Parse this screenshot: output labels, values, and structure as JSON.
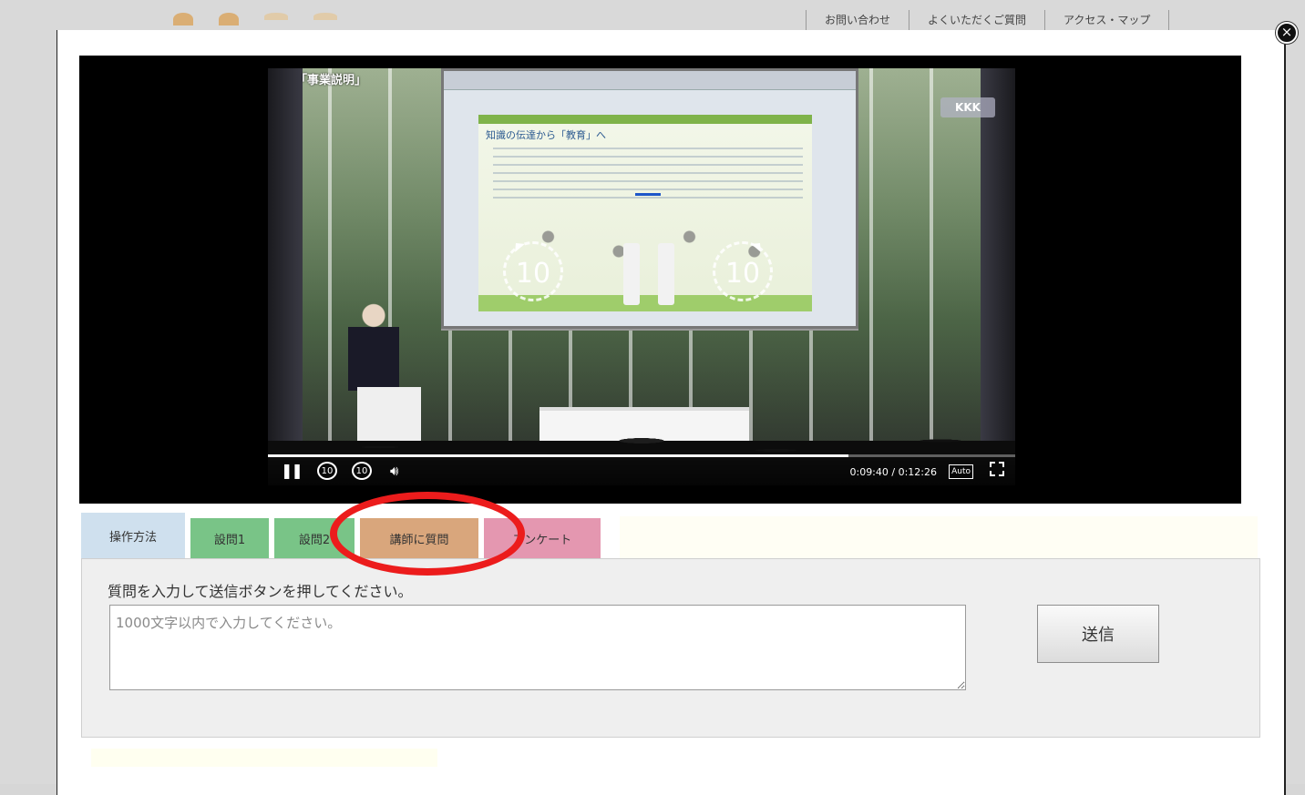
{
  "top_nav": {
    "links": [
      "お問い合わせ",
      "よくいただくご質問",
      "アクセス・マップ"
    ]
  },
  "modal": {
    "close_icon": "×"
  },
  "video": {
    "caption": "「事業説明」",
    "brand": "KKK",
    "slide_title": "知識の伝達から「教育」へ",
    "skip_back_label": "10",
    "skip_forward_label": "10",
    "current_time": "0:09:40",
    "duration": "0:12:26",
    "time_display": "0:09:40 / 0:12:26",
    "progress_fraction": 0.777,
    "quality_label": "Auto",
    "rewind_label": "10",
    "forward_label": "10",
    "icons": {
      "pause": "pause-icon",
      "volume": "volume-icon",
      "fullscreen": "fullscreen-icon"
    }
  },
  "tabs": [
    {
      "label": "操作方法",
      "color": "#cfe0ee"
    },
    {
      "label": "設問1",
      "color": "#79c487"
    },
    {
      "label": "設問2",
      "color": "#79c487"
    },
    {
      "label": "講師に質問",
      "color": "#d9a67c"
    },
    {
      "label": "アンケート",
      "color": "#e497b0"
    }
  ],
  "question_panel": {
    "instruction": "質問を入力して送信ボタンを押してください。",
    "placeholder": "1000文字以内で入力してください。",
    "send_label": "送信"
  },
  "annotation": {
    "color": "#ec1c1c"
  }
}
